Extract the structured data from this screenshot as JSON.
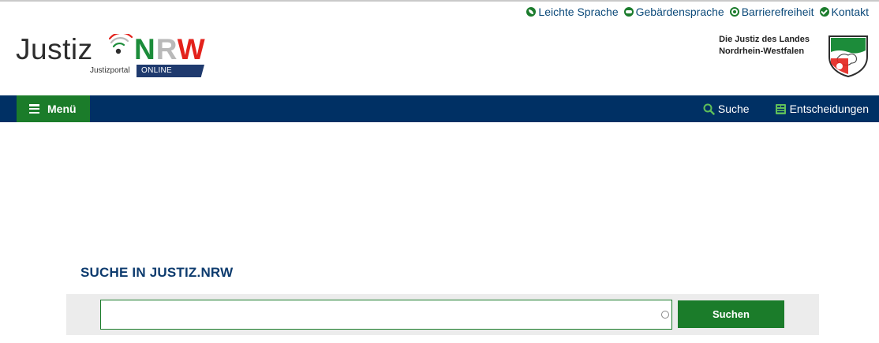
{
  "service_links": [
    {
      "label": "Leichte Sprache",
      "icon": "leaf-icon"
    },
    {
      "label": "Gebärdensprache",
      "icon": "sign-language-icon"
    },
    {
      "label": "Barrierefreiheit",
      "icon": "accessibility-icon"
    },
    {
      "label": "Kontakt",
      "icon": "contact-icon"
    }
  ],
  "logo": {
    "justiz": "Justiz",
    "nrw_n": "N",
    "nrw_r": "R",
    "nrw_w": "W",
    "portal": "Justizportal",
    "online": "ONLINE"
  },
  "state": {
    "line1": "Die Justiz des Landes",
    "line2": "Nordrhein-Westfalen"
  },
  "nav": {
    "menu_label": "Menü",
    "search_label": "Suche",
    "decisions_label": "Entscheidungen"
  },
  "search": {
    "title": "SUCHE IN JUSTIZ.NRW",
    "input_value": "",
    "button_label": "Suchen"
  },
  "colors": {
    "navbar": "#003064",
    "accent_green": "#1b7c2a",
    "nrw_red": "#e3221c",
    "title_blue": "#0d3b6e"
  }
}
